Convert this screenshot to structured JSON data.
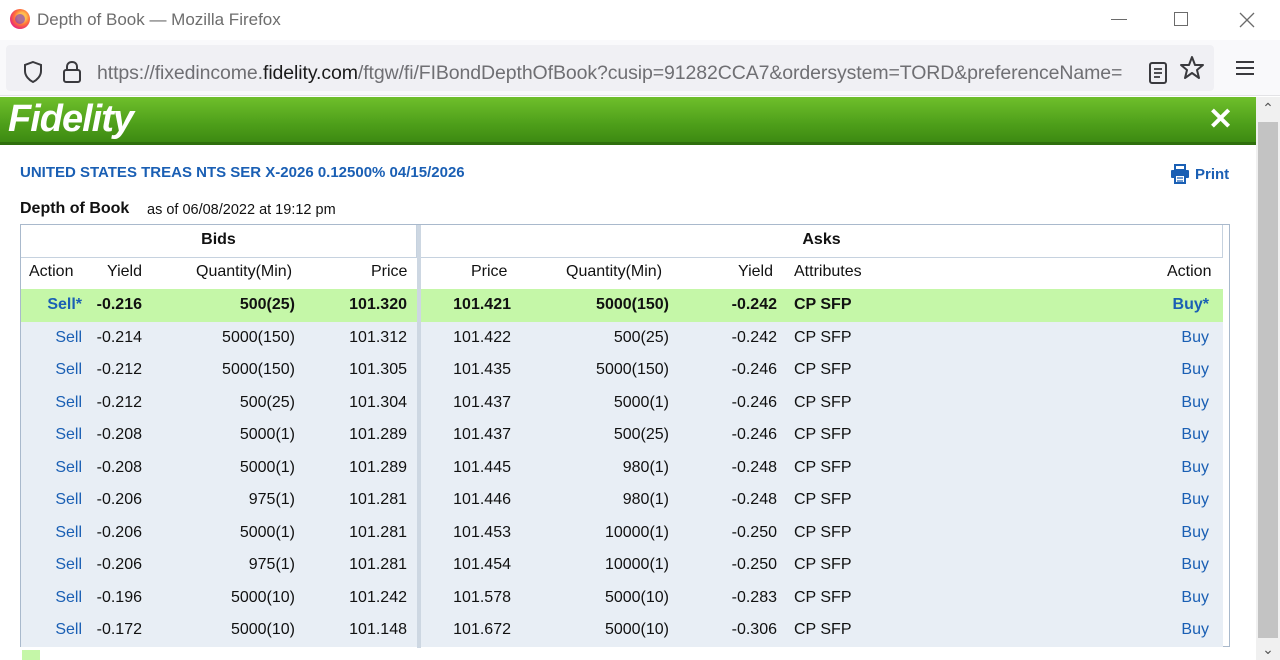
{
  "window": {
    "title": "Depth of Book — Mozilla Firefox"
  },
  "address_bar": {
    "url_prefix": "https://fixedincome.",
    "url_domain": "fidelity.com",
    "url_rest": "/ftgw/fi/FIBondDepthOfBook?cusip=91282CCA7&ordersystem=TORD&preferenceName="
  },
  "banner": {
    "logo": "Fidelity",
    "close": "✕"
  },
  "security_title": "UNITED STATES TREAS NTS SER X-2026 0.12500% 04/15/2026",
  "print_label": "Print",
  "depth_label": "Depth of Book",
  "as_of": "as of 06/08/2022 at 19:12  pm",
  "table": {
    "bids_header": "Bids",
    "asks_header": "Asks",
    "columns": {
      "bid_action": "Action",
      "bid_yield": "Yield",
      "bid_qty": "Quantity(Min)",
      "bid_price": "Price",
      "ask_price": "Price",
      "ask_qty": "Quantity(Min)",
      "ask_yield": "Yield",
      "attributes": "Attributes",
      "ask_action": "Action"
    },
    "rows": [
      {
        "sell": "Sell*",
        "bid_yield": "-0.216",
        "bid_qty": "500(25)",
        "bid_price": "101.320",
        "ask_price": "101.421",
        "ask_qty": "5000(150)",
        "ask_yield": "-0.242",
        "attr": "CP SFP",
        "buy": "Buy*"
      },
      {
        "sell": "Sell",
        "bid_yield": "-0.214",
        "bid_qty": "5000(150)",
        "bid_price": "101.312",
        "ask_price": "101.422",
        "ask_qty": "500(25)",
        "ask_yield": "-0.242",
        "attr": "CP SFP",
        "buy": "Buy"
      },
      {
        "sell": "Sell",
        "bid_yield": "-0.212",
        "bid_qty": "5000(150)",
        "bid_price": "101.305",
        "ask_price": "101.435",
        "ask_qty": "5000(150)",
        "ask_yield": "-0.246",
        "attr": "CP SFP",
        "buy": "Buy"
      },
      {
        "sell": "Sell",
        "bid_yield": "-0.212",
        "bid_qty": "500(25)",
        "bid_price": "101.304",
        "ask_price": "101.437",
        "ask_qty": "5000(1)",
        "ask_yield": "-0.246",
        "attr": "CP SFP",
        "buy": "Buy"
      },
      {
        "sell": "Sell",
        "bid_yield": "-0.208",
        "bid_qty": "5000(1)",
        "bid_price": "101.289",
        "ask_price": "101.437",
        "ask_qty": "500(25)",
        "ask_yield": "-0.246",
        "attr": "CP SFP",
        "buy": "Buy"
      },
      {
        "sell": "Sell",
        "bid_yield": "-0.208",
        "bid_qty": "5000(1)",
        "bid_price": "101.289",
        "ask_price": "101.445",
        "ask_qty": "980(1)",
        "ask_yield": "-0.248",
        "attr": "CP SFP",
        "buy": "Buy"
      },
      {
        "sell": "Sell",
        "bid_yield": "-0.206",
        "bid_qty": "975(1)",
        "bid_price": "101.281",
        "ask_price": "101.446",
        "ask_qty": "980(1)",
        "ask_yield": "-0.248",
        "attr": "CP SFP",
        "buy": "Buy"
      },
      {
        "sell": "Sell",
        "bid_yield": "-0.206",
        "bid_qty": "5000(1)",
        "bid_price": "101.281",
        "ask_price": "101.453",
        "ask_qty": "10000(1)",
        "ask_yield": "-0.250",
        "attr": "CP SFP",
        "buy": "Buy"
      },
      {
        "sell": "Sell",
        "bid_yield": "-0.206",
        "bid_qty": "975(1)",
        "bid_price": "101.281",
        "ask_price": "101.454",
        "ask_qty": "10000(1)",
        "ask_yield": "-0.250",
        "attr": "CP SFP",
        "buy": "Buy"
      },
      {
        "sell": "Sell",
        "bid_yield": "-0.196",
        "bid_qty": "5000(10)",
        "bid_price": "101.242",
        "ask_price": "101.578",
        "ask_qty": "5000(10)",
        "ask_yield": "-0.283",
        "attr": "CP SFP",
        "buy": "Buy"
      },
      {
        "sell": "Sell",
        "bid_yield": "-0.172",
        "bid_qty": "5000(10)",
        "bid_price": "101.148",
        "ask_price": "101.672",
        "ask_qty": "5000(10)",
        "ask_yield": "-0.306",
        "attr": "CP SFP",
        "buy": "Buy"
      }
    ]
  },
  "colors": {
    "brand_green": "#4e9f1a",
    "link_blue": "#1a5fb4",
    "best_row": "#c5f7a8",
    "row_alt": "#e8eef5"
  },
  "icons": [
    "firefox-logo-icon",
    "minimize-icon",
    "maximize-icon",
    "close-icon",
    "shield-icon",
    "lock-icon",
    "reader-view-icon",
    "bookmark-star-icon",
    "menu-icon",
    "printer-icon"
  ]
}
